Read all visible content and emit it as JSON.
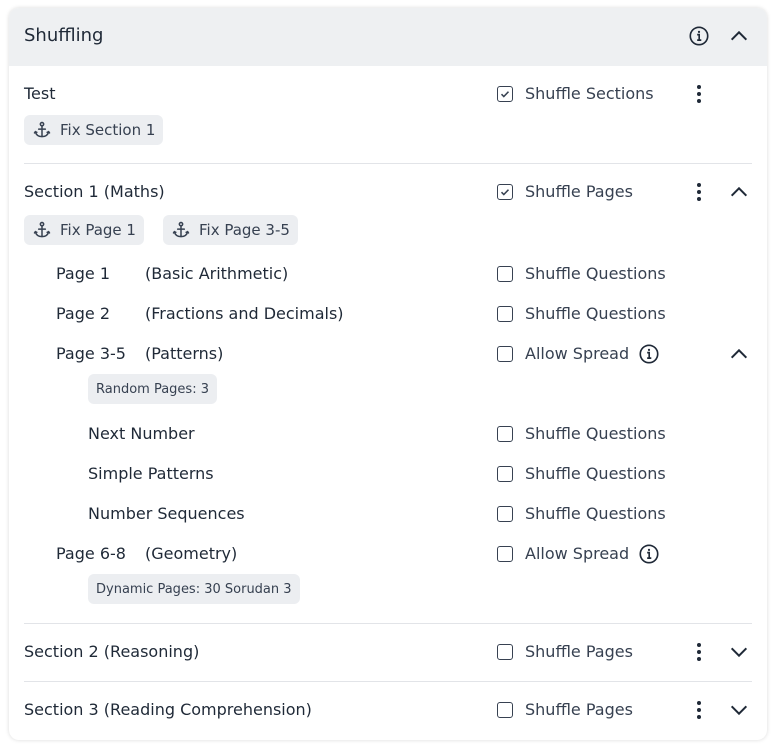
{
  "header": {
    "title": "Shuffling"
  },
  "test": {
    "label": "Test",
    "checkbox": {
      "label": "Shuffle Sections",
      "checked": true
    },
    "chips": [
      "Fix Section 1"
    ]
  },
  "section1": {
    "label": "Section 1 (Maths)",
    "checkbox": {
      "label": "Shuffle Pages",
      "checked": true
    },
    "chips": [
      "Fix Page 1",
      "Fix Page 3-5"
    ],
    "pages": [
      {
        "name": "Page 1",
        "desc": "(Basic Arithmetic)",
        "option": "Shuffle Questions",
        "checked": false
      },
      {
        "name": "Page 2",
        "desc": "(Fractions and Decimals)",
        "option": "Shuffle Questions",
        "checked": false
      },
      {
        "name": "Page 3-5",
        "desc": "(Patterns)",
        "option": "Allow Spread",
        "checked": false,
        "chip": "Random Pages: 3",
        "items": [
          {
            "name": "Next Number",
            "option": "Shuffle Questions",
            "checked": false
          },
          {
            "name": "Simple Patterns",
            "option": "Shuffle Questions",
            "checked": false
          },
          {
            "name": "Number Sequences",
            "option": "Shuffle Questions",
            "checked": false
          }
        ]
      },
      {
        "name": "Page 6-8",
        "desc": "(Geometry)",
        "option": "Allow Spread",
        "checked": false,
        "chip": "Dynamic Pages: 30 Sorudan 3"
      }
    ]
  },
  "section2": {
    "label": "Section 2 (Reasoning)",
    "checkbox": {
      "label": "Shuffle Pages",
      "checked": false
    }
  },
  "section3": {
    "label": "Section 3 (Reading Comprehension)",
    "checkbox": {
      "label": "Shuffle Pages",
      "checked": false
    }
  }
}
